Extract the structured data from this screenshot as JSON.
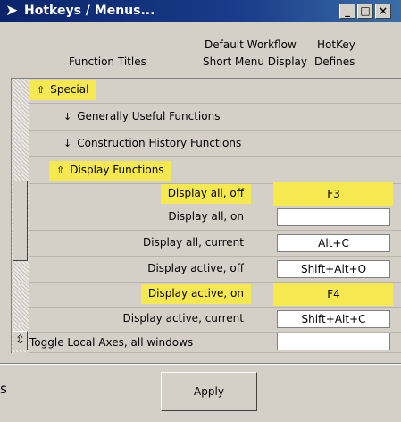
{
  "window": {
    "title": "Hotkeys / Menus...",
    "icon": "arrow-right-icon",
    "buttons": {
      "minimize": "_",
      "maximize": "□",
      "close": "×"
    }
  },
  "headers": {
    "function_titles": "Function Titles",
    "col2_line1": "Default Workflow",
    "col2_line2": "Short Menu Display",
    "col3_line1": "HotKey",
    "col3_line2": "Defines"
  },
  "rows": [
    {
      "kind": "section",
      "label": "Special",
      "icon": "collapse-up-icon",
      "highlight": true
    },
    {
      "kind": "section",
      "label": "Generally Useful Functions",
      "icon": "expand-down-icon",
      "highlight": false
    },
    {
      "kind": "section",
      "label": "Construction History Functions",
      "icon": "expand-down-icon",
      "highlight": false
    },
    {
      "kind": "section",
      "label": "Display Functions",
      "icon": "collapse-up-icon",
      "highlight": true
    },
    {
      "kind": "item",
      "label": "Display all, off",
      "hotkey": "F3",
      "highlight": true
    },
    {
      "kind": "item",
      "label": "Display all, on",
      "hotkey": "",
      "highlight": false
    },
    {
      "kind": "item",
      "label": "Display all, current",
      "hotkey": "Alt+C",
      "highlight": false
    },
    {
      "kind": "item",
      "label": "Display active, off",
      "hotkey": "Shift+Alt+O",
      "highlight": false
    },
    {
      "kind": "item",
      "label": "Display active, on",
      "hotkey": "F4",
      "highlight": true
    },
    {
      "kind": "item",
      "label": "Display active, current",
      "hotkey": "Shift+Alt+C",
      "highlight": false
    },
    {
      "kind": "item",
      "label": "Toggle Local Axes, all windows",
      "hotkey": "",
      "highlight": false
    }
  ],
  "apply_label": "Apply",
  "side_letter": "s",
  "glyphs": {
    "collapse": "⇧",
    "expand": "↓",
    "scroll": "⇳"
  },
  "colors": {
    "highlight": "#f5e850",
    "titlebar": "#0a246a",
    "panel": "#d4d0c8"
  }
}
